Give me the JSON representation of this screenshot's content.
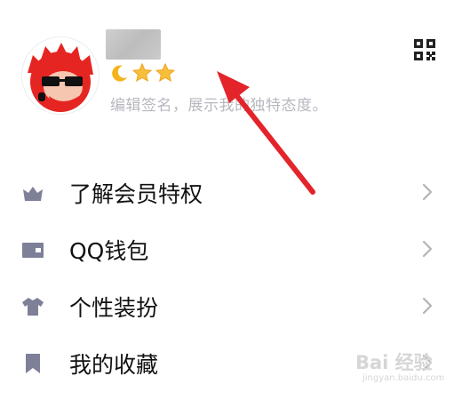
{
  "profile": {
    "signature": "编辑签名，展示我的独特态度。",
    "level_icons": [
      "moon-icon",
      "star-icon",
      "star-icon"
    ]
  },
  "menu": {
    "items": [
      {
        "label": "了解会员特权",
        "icon": "crown-icon"
      },
      {
        "label": "QQ钱包",
        "icon": "wallet-icon"
      },
      {
        "label": "个性装扮",
        "icon": "shirt-icon"
      },
      {
        "label": "我的收藏",
        "icon": "bookmark-icon"
      }
    ]
  },
  "watermark": {
    "main": "Bai 经验",
    "sub": "jingyan.baidu.com"
  },
  "colors": {
    "icon_gray": "#7d8097",
    "chevron": "#b3b3b8",
    "signature": "#b7b7c0",
    "arrow": "#e3242b"
  }
}
